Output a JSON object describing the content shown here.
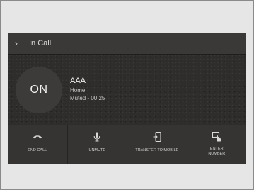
{
  "header": {
    "chevron_icon": "chevron-right-icon",
    "title": "In Call"
  },
  "call": {
    "status_circle": "ON",
    "caller_name": "AAA",
    "caller_type": "Home",
    "call_status": "Muted - 00:25"
  },
  "actions": [
    {
      "label": "END CALL",
      "icon": "end-call-icon"
    },
    {
      "label": "UNMUTE",
      "icon": "microphone-icon"
    },
    {
      "label": "TRANSFER TO MOBILE",
      "icon": "transfer-to-mobile-icon"
    },
    {
      "label": "ENTER\nNUMBER",
      "icon": "keypad-hand-icon"
    }
  ],
  "colors": {
    "screen_bg": "#2e2d2b",
    "header_bg": "#3a3937",
    "text": "#f2f2f2"
  }
}
